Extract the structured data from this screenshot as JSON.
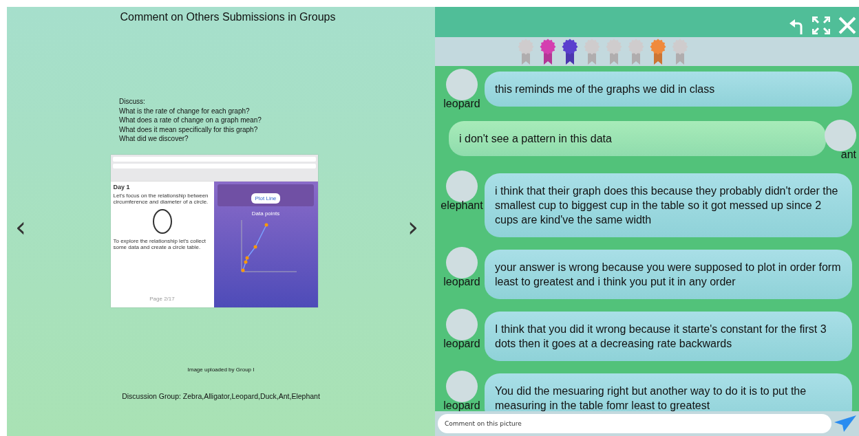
{
  "slide": {
    "title": "Comment on Others Submissions in Groups",
    "prompt": [
      "Discuss:",
      "What is the rate of change for each graph?",
      "What does a rate of change on a graph mean?",
      "What does it mean specifically for this graph?",
      "What did we discover?"
    ],
    "uploaded_screenshot": {
      "heading": "Day 1",
      "intro": "Let's focus on the relationship between circumference and diameter of a circle.",
      "instruction": "To explore the relationship let's collect some data and create a circle table.",
      "page": "Page 2/17",
      "button": "Plot Line",
      "chart_title": "Data points"
    },
    "caption": "Image uploaded by Group I",
    "group": "Discussion Group: Zebra,Alligator,Leopard,Duck,Ant,Elephant",
    "prev": "‹",
    "next": "›"
  },
  "ribbons": [
    {
      "color": "#cfcccd"
    },
    {
      "color": "#d43fb0"
    },
    {
      "color": "#5a3fce"
    },
    {
      "color": "#cfcccd"
    },
    {
      "color": "#cfcccd"
    },
    {
      "color": "#cfcccd"
    },
    {
      "color": "#f08a3c"
    },
    {
      "color": "#cfcccd"
    }
  ],
  "messages": [
    {
      "kind": "left",
      "author": "leopard",
      "text": "this reminds me of the graphs we did in class"
    },
    {
      "kind": "right",
      "author": "ant",
      "text": "i don't see a pattern in this data"
    },
    {
      "kind": "left",
      "author": "elephant",
      "text": "i think that their graph does this because they probably didn't order the smallest cup to biggest cup in the table so it got messed up since 2 cups are kind've the same width"
    },
    {
      "kind": "left",
      "author": "leopard",
      "text": "your answer is wrong because you were supposed to plot in order form least to greatest and i think you put it in any order"
    },
    {
      "kind": "left",
      "author": "leopard",
      "text": "I think that you did it wrong because it starte's constant for the first 3 dots then it goes at a decreasing rate backwards"
    },
    {
      "kind": "left",
      "author": "leopard",
      "text": "You did the mesuaring right but another way to do it is to put the measuring in the table fomr least to greatest"
    }
  ],
  "comment": {
    "placeholder": "Comment on this picture"
  }
}
